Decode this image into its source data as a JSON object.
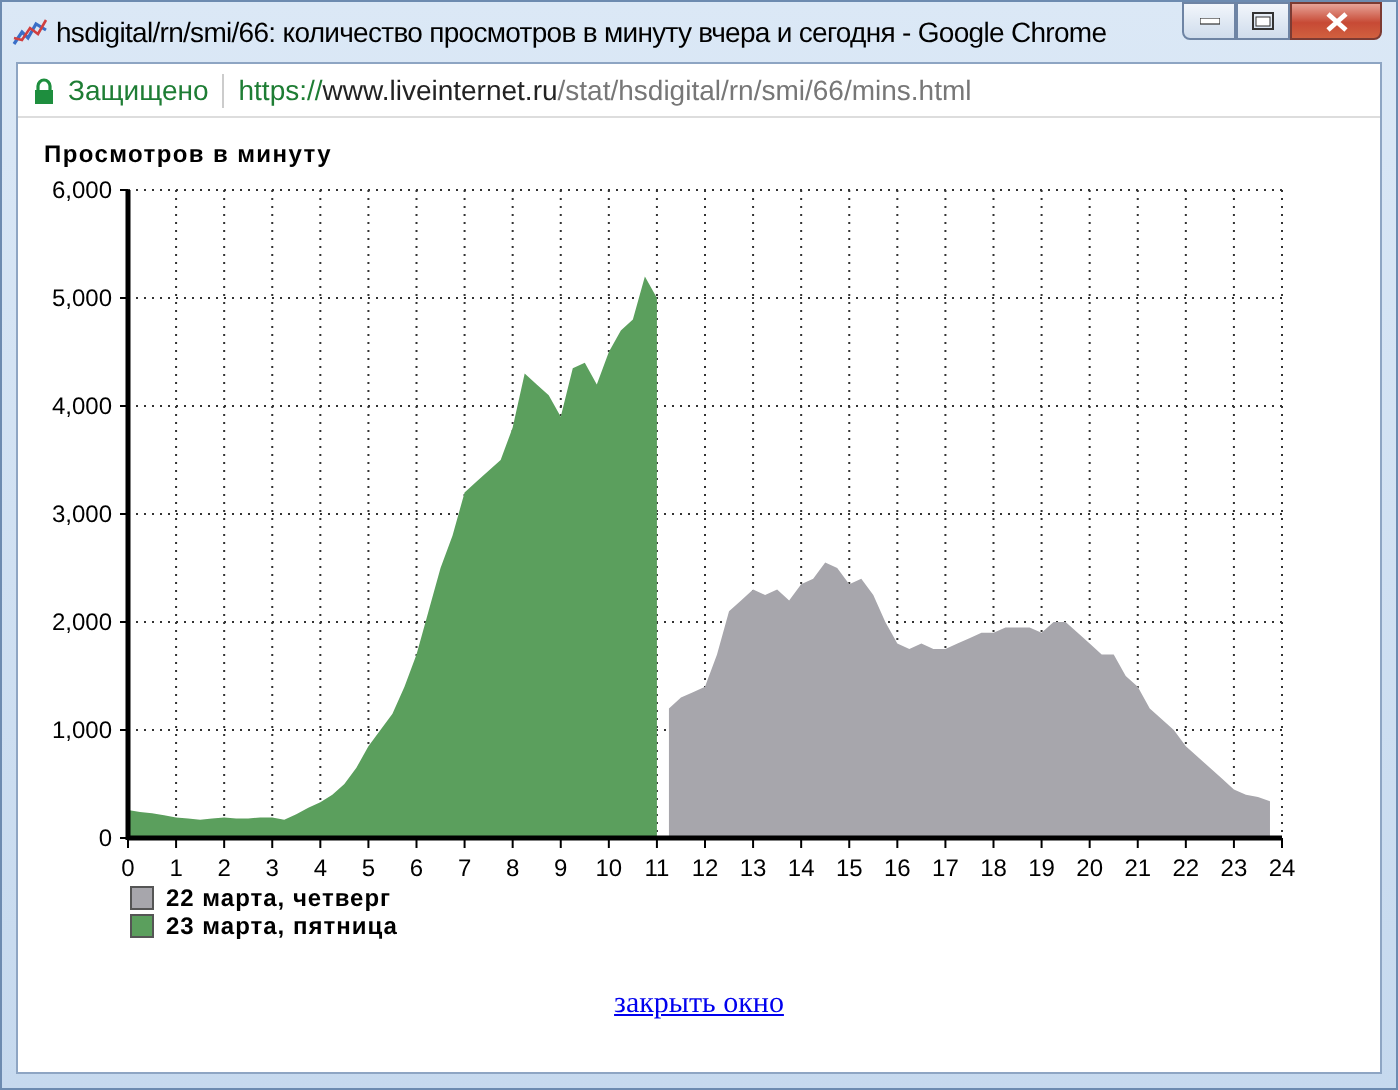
{
  "window": {
    "title": "hsdigital/rn/smi/66: количество просмотров в минуту вчера и сегодня - Google Chrome"
  },
  "address_bar": {
    "security": "Защищено",
    "url_scheme": "https://",
    "url_host": "www.liveinternet.ru",
    "url_path": "/stat/hsdigital/rn/smi/66/mins.html"
  },
  "chart": {
    "chart_data": {
      "type": "area",
      "title": "Просмотров в минуту",
      "x": [
        0,
        0.25,
        0.5,
        0.75,
        1,
        1.25,
        1.5,
        1.75,
        2,
        2.25,
        2.5,
        2.75,
        3,
        3.25,
        3.5,
        3.75,
        4,
        4.25,
        4.5,
        4.75,
        5,
        5.25,
        5.5,
        5.75,
        6,
        6.25,
        6.5,
        6.75,
        7,
        7.25,
        7.5,
        7.75,
        8,
        8.25,
        8.5,
        8.75,
        9,
        9.25,
        9.5,
        9.75,
        10,
        10.25,
        10.5,
        10.75,
        11,
        11.25,
        11.5,
        11.75,
        12,
        12.25,
        12.5,
        12.75,
        13,
        13.25,
        13.5,
        13.75,
        14,
        14.25,
        14.5,
        14.75,
        15,
        15.25,
        15.5,
        15.75,
        16,
        16.25,
        16.5,
        16.75,
        17,
        17.25,
        17.5,
        17.75,
        18,
        18.25,
        18.5,
        18.75,
        19,
        19.25,
        19.5,
        19.75,
        20,
        20.25,
        20.5,
        20.75,
        21,
        21.25,
        21.5,
        21.75,
        22,
        22.25,
        22.5,
        22.75,
        23,
        23.25,
        23.5,
        23.75
      ],
      "series": [
        {
          "name": "22 марта, четверг",
          "color": "#a7a6ac",
          "values": [
            null,
            null,
            null,
            null,
            null,
            null,
            null,
            null,
            null,
            null,
            null,
            null,
            null,
            null,
            null,
            null,
            null,
            null,
            null,
            null,
            null,
            null,
            null,
            null,
            null,
            null,
            null,
            null,
            null,
            null,
            null,
            null,
            null,
            null,
            null,
            null,
            null,
            null,
            null,
            null,
            null,
            null,
            null,
            null,
            null,
            1200,
            1300,
            1350,
            1400,
            1700,
            2100,
            2200,
            2300,
            2250,
            2300,
            2200,
            2350,
            2400,
            2550,
            2500,
            2350,
            2400,
            2250,
            2000,
            1800,
            1750,
            1800,
            1750,
            1750,
            1800,
            1850,
            1900,
            1900,
            1950,
            1950,
            1950,
            1900,
            2000,
            2000,
            1900,
            1800,
            1700,
            1700,
            1500,
            1400,
            1200,
            1100,
            1000,
            850,
            750,
            650,
            550,
            450,
            400,
            380,
            340
          ]
        },
        {
          "name": "23 марта, пятница",
          "color": "#5b9f5d",
          "values": [
            260,
            240,
            230,
            210,
            190,
            180,
            170,
            180,
            190,
            180,
            180,
            190,
            190,
            170,
            220,
            280,
            330,
            400,
            500,
            650,
            850,
            1000,
            1150,
            1400,
            1700,
            2100,
            2500,
            2800,
            3200,
            3300,
            3400,
            3500,
            3800,
            4300,
            4200,
            4100,
            3900,
            4350,
            4400,
            4200,
            4500,
            4700,
            4800,
            5200,
            5000,
            null,
            null,
            null,
            null,
            null,
            null,
            null,
            null,
            null,
            null,
            null,
            null,
            null,
            null,
            null,
            null,
            null,
            null,
            null,
            null,
            null,
            null,
            null,
            null,
            null,
            null,
            null,
            null,
            null,
            null,
            null,
            null,
            null,
            null,
            null,
            null,
            null,
            null,
            null,
            null,
            null,
            null,
            null,
            null,
            null,
            null,
            null,
            null,
            null,
            null,
            null
          ]
        }
      ],
      "grid": true,
      "xlim": [
        0,
        24
      ],
      "ylim": [
        0,
        6000
      ],
      "xticks": [
        0,
        1,
        2,
        3,
        4,
        5,
        6,
        7,
        8,
        9,
        10,
        11,
        12,
        13,
        14,
        15,
        16,
        17,
        18,
        19,
        20,
        21,
        22,
        23,
        24
      ],
      "yticks": [
        {
          "value": 0,
          "label": "0"
        },
        {
          "value": 1000,
          "label": "1,000"
        },
        {
          "value": 2000,
          "label": "2,000"
        },
        {
          "value": 3000,
          "label": "3,000"
        },
        {
          "value": 4000,
          "label": "4,000"
        },
        {
          "value": 5000,
          "label": "5,000"
        },
        {
          "value": 6000,
          "label": "6,000"
        }
      ]
    }
  },
  "close_link": "закрыть окно"
}
